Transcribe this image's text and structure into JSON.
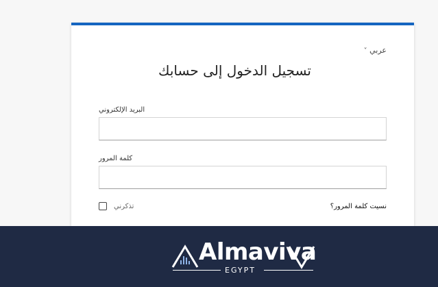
{
  "login": {
    "language_label": "عربي",
    "title": "تسجيل الدخول إلى حسابك",
    "email_label": "البريد الإلكتروني",
    "email_value": "",
    "password_label": "كلمة المرور",
    "password_value": "",
    "remember_label": "تذكرني",
    "forgot_password": "نسيت كلمة المرور؟"
  },
  "footer": {
    "logo_name": "Almaviva",
    "logo_subtitle": "EGYPT"
  },
  "colors": {
    "accent": "#1565c0",
    "footer_bg": "#1f2a44"
  },
  "icons": {
    "language_chevron": "chevron-down-icon",
    "logo_wave": "sound-wave-icon"
  }
}
